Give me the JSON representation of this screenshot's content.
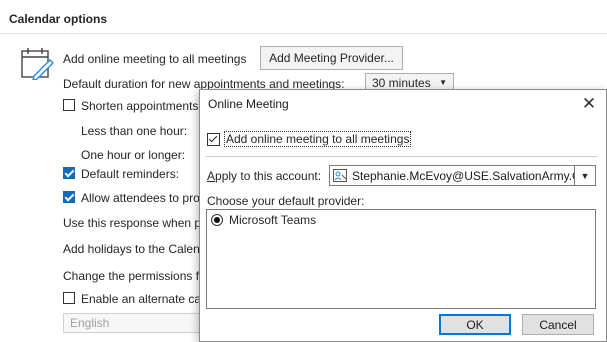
{
  "section": {
    "title": "Calendar options"
  },
  "options": {
    "add_online_meeting_label": "Add online meeting to all meetings",
    "add_provider_button": "Add Meeting Provider...",
    "default_duration_label": "Default duration for new appointments and meetings:",
    "default_duration_value": "30 minutes",
    "shorten_label": "Shorten appointments",
    "less_than_hour_label": "Less than one hour:",
    "one_hour_label": "One hour or longer:",
    "default_reminders_label": "Default reminders:",
    "allow_attendees_label": "Allow attendees to pro",
    "use_response_label": "Use this response when pr",
    "add_holidays_label": "Add holidays to the Calen",
    "change_permissions_label": "Change the permissions fo",
    "alternate_calendar_label": "Enable an alternate cal",
    "language_value": "English"
  },
  "dialog": {
    "title": "Online Meeting",
    "add_online_meeting_label": "Add online meeting to all meetings",
    "apply_account_label": "Apply to this account:",
    "account_value": "Stephanie.McEvoy@USE.SalvationArmy.Org",
    "provider_label": "Choose your default provider:",
    "providers": [
      "Microsoft Teams"
    ],
    "ok_label": "OK",
    "cancel_label": "Cancel"
  },
  "colors": {
    "accent": "#0f6cbd",
    "focus": "#0078d7"
  },
  "icons": [
    "calendar-pencil-icon",
    "close-icon",
    "chevron-down-icon",
    "account-icon"
  ]
}
